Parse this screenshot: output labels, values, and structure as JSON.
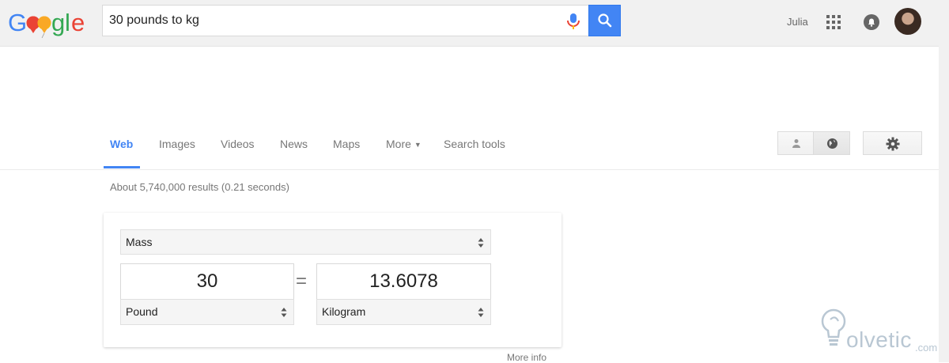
{
  "header": {
    "logo_text": "Google",
    "search_query": "30 pounds to kg",
    "user_name": "Julia",
    "colors": {
      "search_button": "#4285f4",
      "active_tab": "#4285f4"
    }
  },
  "tabs": [
    {
      "label": "Web",
      "active": true
    },
    {
      "label": "Images",
      "active": false
    },
    {
      "label": "Videos",
      "active": false
    },
    {
      "label": "News",
      "active": false
    },
    {
      "label": "Maps",
      "active": false
    },
    {
      "label": "More",
      "active": false
    },
    {
      "label": "Search tools",
      "active": false
    }
  ],
  "results": {
    "stats": "About 5,740,000 results (0.21 seconds)"
  },
  "converter": {
    "unit_type": "Mass",
    "from_value": "30",
    "from_unit": "Pound",
    "equals": "=",
    "to_value": "13.6078",
    "to_unit": "Kilogram",
    "more_info": "More info"
  },
  "watermark": {
    "text": "olvetic",
    "suffix": ".com"
  }
}
